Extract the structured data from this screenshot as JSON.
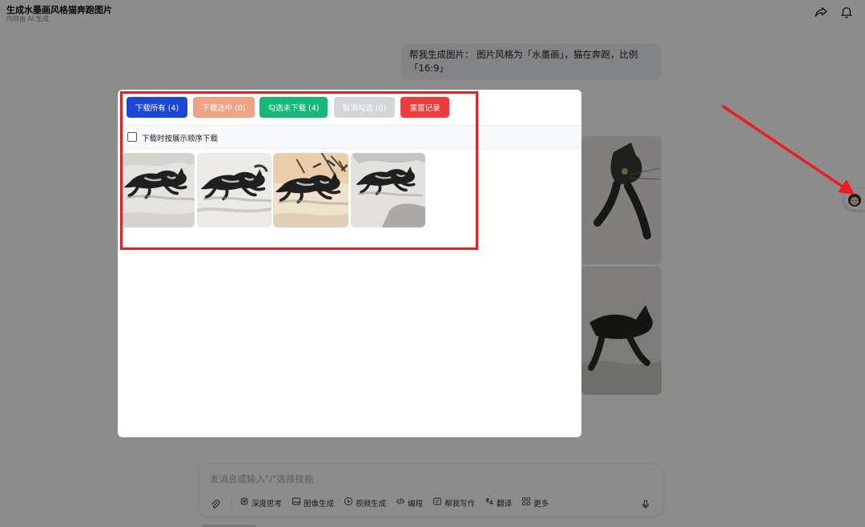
{
  "header": {
    "title": "生成水墨画风格猫奔跑图片",
    "subtitle": "内容由 AI 生成",
    "share_icon": "share-icon",
    "bell_icon": "bell-icon"
  },
  "conversation": {
    "user_message": "帮我生成图片： 图片风格为「水墨画」，猫在奔跑，比例「16:9」"
  },
  "composer": {
    "placeholder": "发消息或输入\"/\"选择技能",
    "tools": [
      {
        "label": "深度思考",
        "icon": "think-icon"
      },
      {
        "label": "图像生成",
        "icon": "image-icon"
      },
      {
        "label": "视频生成",
        "icon": "video-icon"
      },
      {
        "label": "编程",
        "icon": "code-icon"
      },
      {
        "label": "帮我写作",
        "icon": "write-icon"
      },
      {
        "label": "翻译",
        "icon": "translate-icon"
      },
      {
        "label": "更多",
        "icon": "grid-icon"
      }
    ]
  },
  "dialog": {
    "buttons": [
      {
        "label": "下载所有 (4)",
        "color": "#1a47d6"
      },
      {
        "label": "下载选中 (0)",
        "color": "#f0a283"
      },
      {
        "label": "勾选未下载 (4)",
        "color": "#14b877"
      },
      {
        "label": "取消勾选 (0)",
        "color": "#d2d5da"
      },
      {
        "label": "重置记录",
        "color": "#ef3b3b"
      }
    ],
    "checkbox_label": "下载时按展示顺序下载",
    "checkbox_checked": false
  },
  "colors": {
    "annotation_red": "#ee1c1c",
    "overlay": "rgba(0,0,0,0.45)"
  }
}
